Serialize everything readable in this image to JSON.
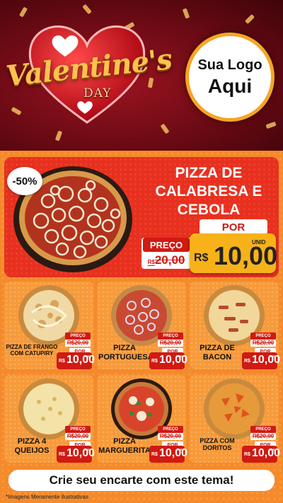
{
  "header": {
    "title": "Valentine's",
    "subtitle": "DAY",
    "logo_line1": "Sua Logo",
    "logo_line2": "Aqui"
  },
  "featured": {
    "discount": "-50%",
    "name": "PIZZA DE CALABRESA E CEBOLA",
    "por_label": "POR",
    "preco_label": "PREÇO",
    "old_currency": "R$",
    "old_price": "20,00",
    "new_currency": "R$",
    "new_price": "10,00",
    "unid_label": "UNID"
  },
  "items": [
    {
      "name": "PIZZA DE FRANGO COM CATUPIRY",
      "preco_label": "PREÇO",
      "old_price": "R$20,00",
      "por_label": "POR",
      "currency": "R$",
      "new_price": "10,00",
      "unid_label": "UNID",
      "topping": "chicken"
    },
    {
      "name": "PIZZA PORTUGUESA",
      "preco_label": "PREÇO",
      "old_price": "R$20,00",
      "por_label": "POR",
      "currency": "R$",
      "new_price": "10,00",
      "unid_label": "UNID",
      "topping": "onion"
    },
    {
      "name": "PIZZA DE BACON",
      "preco_label": "PREÇO",
      "old_price": "R$20,00",
      "por_label": "POR",
      "currency": "R$",
      "new_price": "10,00",
      "unid_label": "UNID",
      "topping": "bacon"
    },
    {
      "name": "PIZZA 4 QUEIJOS",
      "preco_label": "PREÇO",
      "old_price": "R$20,00",
      "por_label": "POR",
      "currency": "R$",
      "new_price": "10,00",
      "unid_label": "UNID",
      "topping": "cheese"
    },
    {
      "name": "PIZZA MARGUERITA",
      "preco_label": "PREÇO",
      "old_price": "R$20,00",
      "por_label": "POR",
      "currency": "R$",
      "new_price": "10,00",
      "unid_label": "UNID",
      "topping": "margherita"
    },
    {
      "name": "PIZZA COM DORITOS",
      "preco_label": "PREÇO",
      "old_price": "R$20,00",
      "por_label": "POR",
      "currency": "R$",
      "new_price": "10,00",
      "unid_label": "UNID",
      "topping": "doritos"
    }
  ],
  "footer": {
    "cta": "Crie seu encarte com este tema!",
    "disclaimer": "*Imagens Meramente Ilustrativas"
  },
  "colors": {
    "header_bg": "#6a0a14",
    "accent_red": "#d01a12",
    "accent_orange": "#f58a2a",
    "price_yellow": "#f7b21a",
    "title_gold": "#ffc24d"
  },
  "icons": [
    "heart-icon",
    "balloon-heart-icon",
    "confetti-icon",
    "pizza-image"
  ]
}
